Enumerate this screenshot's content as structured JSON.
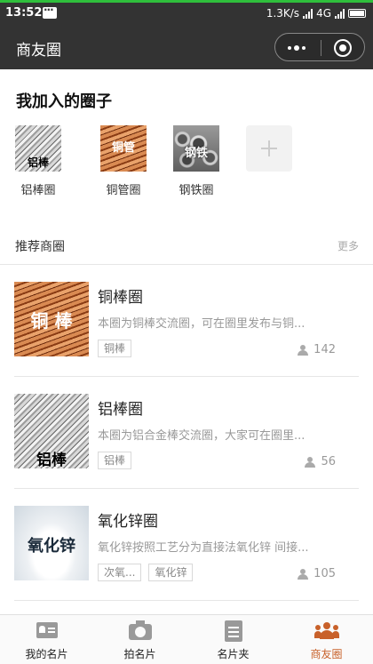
{
  "status_bar": {
    "time": "13:52",
    "net_speed": "1.3K/s",
    "network": "4G",
    "colors": {
      "background": "#333333",
      "top_line": "#2fbf3c"
    }
  },
  "nav": {
    "title": "商友圈"
  },
  "joined": {
    "title": "我加入的圈子",
    "items": [
      {
        "label": "铝棒圈",
        "overlay": "铝棒",
        "icon": "aluminum-rods-thumbnail"
      },
      {
        "label": "铜管圈",
        "overlay": "铜管",
        "icon": "copper-pipes-thumbnail"
      },
      {
        "label": "钢铁圈",
        "overlay": "钢铁",
        "icon": "steel-pipes-thumbnail"
      }
    ],
    "add_icon": "plus-icon"
  },
  "recommended": {
    "title": "推荐商圈",
    "more": "更多",
    "items": [
      {
        "name": "铜棒圈",
        "desc": "本圈为铜棒交流圈，可在圈里发布与铜...",
        "tags": [
          "铜棒"
        ],
        "members": "142",
        "overlay": "铜 棒",
        "icon": "copper-rods-image"
      },
      {
        "name": "铝棒圈",
        "desc": "本圈为铝合金棒交流圈，大家可在圈里...",
        "tags": [
          "铝棒"
        ],
        "members": "56",
        "overlay": "铝棒",
        "icon": "aluminum-rods-image"
      },
      {
        "name": "氧化锌圈",
        "desc": "氧化锌按照工艺分为直接法氧化锌 间接...",
        "tags": [
          "次氧...",
          "氧化锌"
        ],
        "members": "105",
        "overlay": "氧化锌",
        "icon": "zinc-oxide-powder-image"
      }
    ]
  },
  "tabbar": {
    "tabs": [
      {
        "label": "我的名片",
        "icon": "id-card-icon"
      },
      {
        "label": "拍名片",
        "icon": "camera-icon"
      },
      {
        "label": "名片夹",
        "icon": "clipboard-icon"
      },
      {
        "label": "商友圈",
        "icon": "people-group-icon"
      }
    ],
    "active_color": "#c8612a"
  }
}
